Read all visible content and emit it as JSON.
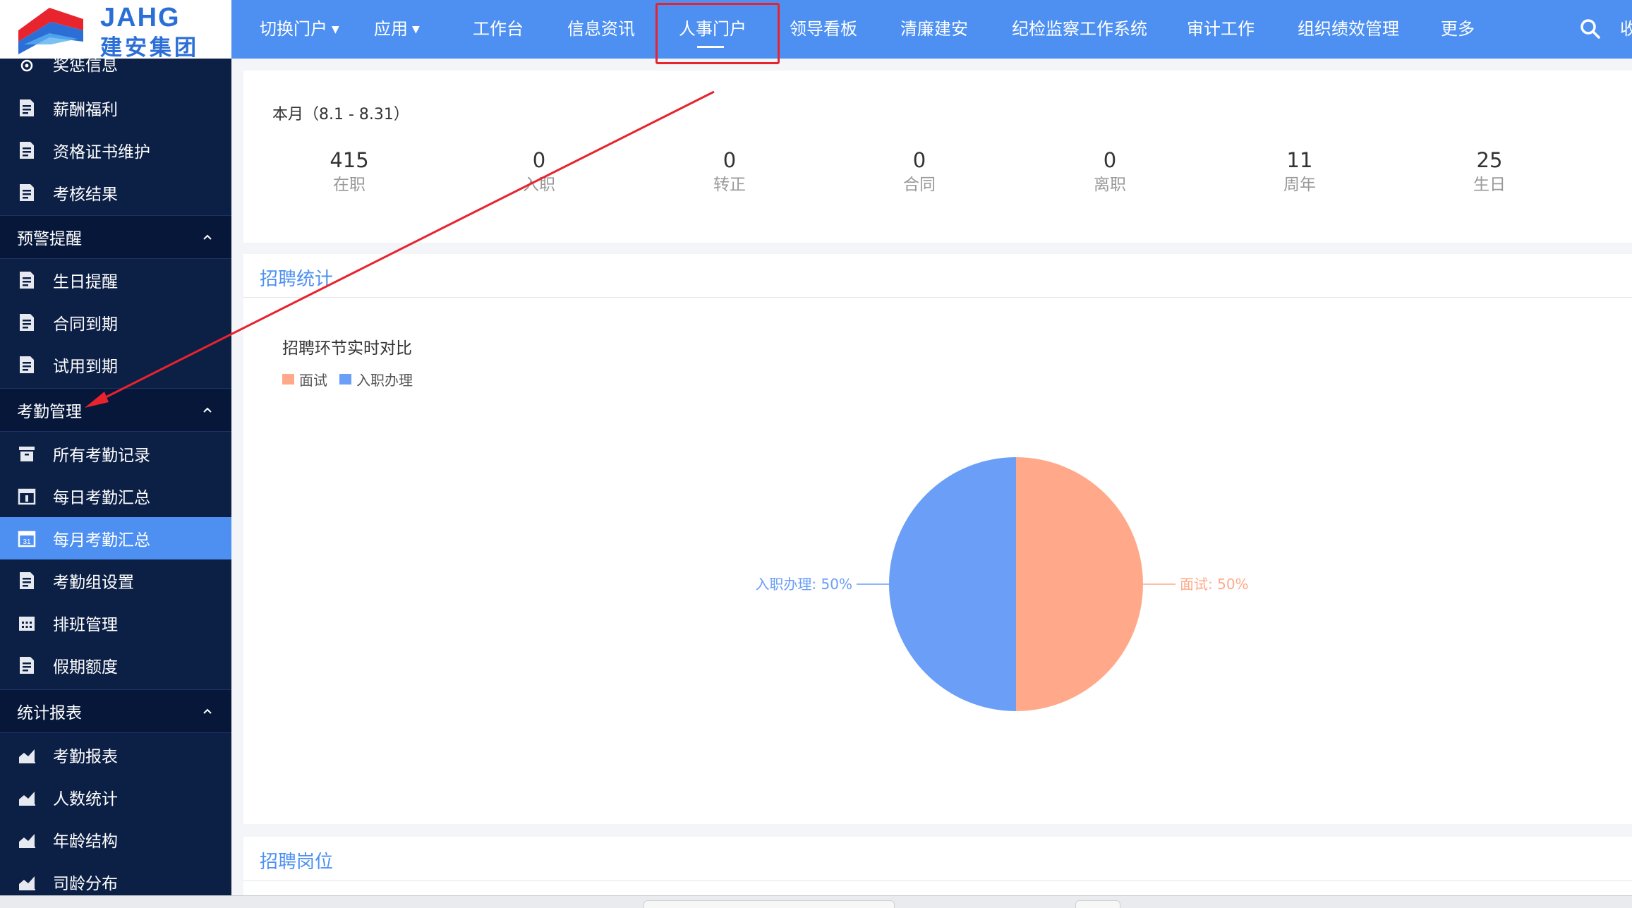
{
  "header": {
    "logo_en": "JAHG",
    "logo_cn": "建安集团",
    "nav": [
      {
        "label": "切换门户",
        "caret": true
      },
      {
        "label": "应用",
        "caret": true
      },
      {
        "label": "工作台"
      },
      {
        "label": "信息资讯"
      },
      {
        "label": "人事门户",
        "active": true
      },
      {
        "label": "领导看板"
      },
      {
        "label": "清廉建安"
      },
      {
        "label": "纪检监察工作系统"
      },
      {
        "label": "审计工作"
      },
      {
        "label": "组织绩效管理"
      },
      {
        "label": "更多"
      }
    ],
    "cut_label": "收",
    "accent_color": "#4d90f2"
  },
  "sidebar": {
    "partial_top": {
      "label": "奖惩信息",
      "icon": "medal-icon"
    },
    "items_top": [
      {
        "label": "薪酬福利",
        "icon": "document-icon"
      },
      {
        "label": "资格证书维护",
        "icon": "document-icon"
      },
      {
        "label": "考核结果",
        "icon": "document-icon"
      }
    ],
    "groups": [
      {
        "label": "预警提醒",
        "items": [
          {
            "label": "生日提醒",
            "icon": "document-icon"
          },
          {
            "label": "合同到期",
            "icon": "document-icon"
          },
          {
            "label": "试用到期",
            "icon": "document-icon"
          }
        ]
      },
      {
        "label": "考勤管理",
        "items": [
          {
            "label": "所有考勤记录",
            "icon": "archive-icon"
          },
          {
            "label": "每日考勤汇总",
            "icon": "calendar-day-icon"
          },
          {
            "label": "每月考勤汇总",
            "icon": "calendar-month-icon",
            "active": true
          },
          {
            "label": "考勤组设置",
            "icon": "document-icon"
          },
          {
            "label": "排班管理",
            "icon": "calendar-grid-icon"
          },
          {
            "label": "假期额度",
            "icon": "document-icon"
          }
        ]
      },
      {
        "label": "统计报表",
        "items": [
          {
            "label": "考勤报表",
            "icon": "area-chart-icon"
          },
          {
            "label": "人数统计",
            "icon": "area-chart-icon"
          },
          {
            "label": "年龄结构",
            "icon": "area-chart-icon"
          },
          {
            "label": "司龄分布",
            "icon": "area-chart-icon"
          }
        ]
      }
    ],
    "active_color": "#4d90f2",
    "bg_color": "#0c1f45"
  },
  "summary": {
    "period_label": "本月（8.1 - 8.31）",
    "stats": [
      {
        "value": "415",
        "label": "在职"
      },
      {
        "value": "0",
        "label": "入职"
      },
      {
        "value": "0",
        "label": "转正"
      },
      {
        "value": "0",
        "label": "合同"
      },
      {
        "value": "0",
        "label": "离职"
      },
      {
        "value": "11",
        "label": "周年"
      },
      {
        "value": "25",
        "label": "生日"
      }
    ]
  },
  "recruitment": {
    "section_title": "招聘统计",
    "chart_title": "招聘环节实时对比",
    "legend": [
      {
        "label": "面试",
        "color": "#ffa98a"
      },
      {
        "label": "入职办理",
        "color": "#6a9ef7"
      }
    ],
    "slice_labels": [
      "面试: 50%",
      "入职办理: 50%"
    ]
  },
  "positions": {
    "section_title": "招聘岗位"
  },
  "chart_data": {
    "type": "pie",
    "title": "招聘环节实时对比",
    "categories": [
      "面试",
      "入职办理"
    ],
    "values": [
      50,
      50
    ],
    "unit": "%",
    "colors": [
      "#ffa98a",
      "#6a9ef7"
    ],
    "legend": "top-left"
  },
  "annotation": {
    "color": "#e8232e"
  }
}
